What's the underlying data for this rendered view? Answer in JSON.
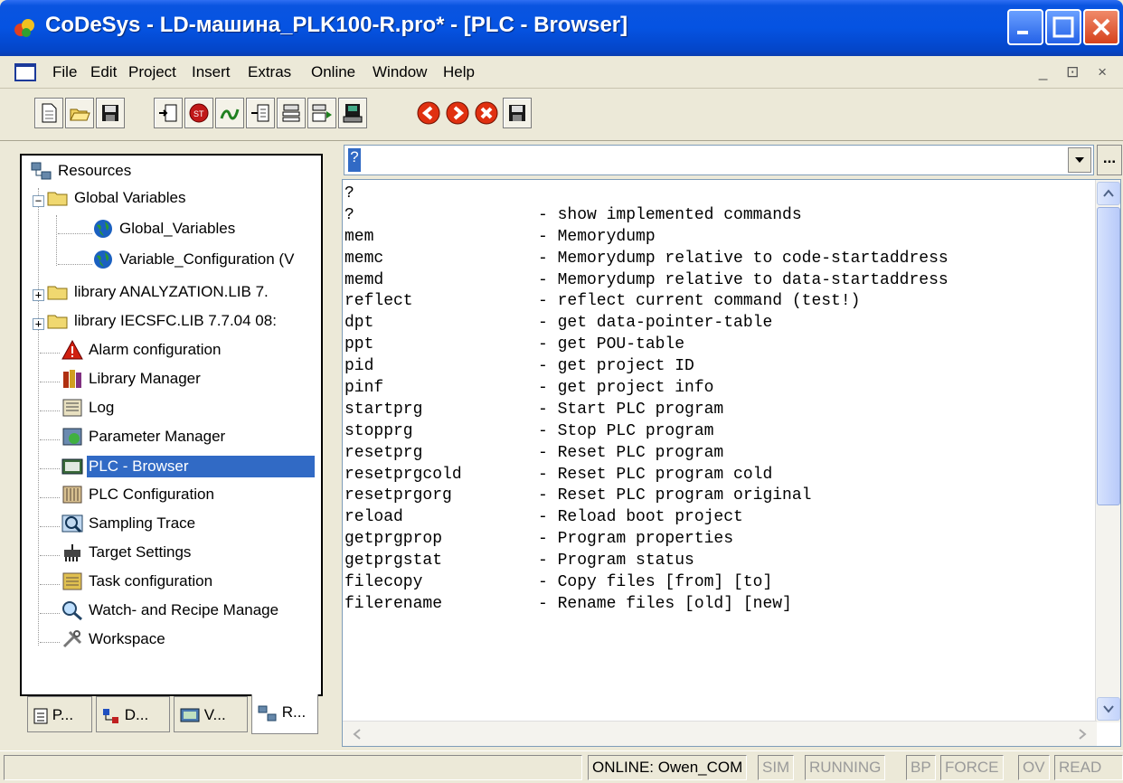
{
  "window": {
    "title": "CoDeSys - LD-машина_PLK100-R.pro* - [PLC - Browser]",
    "buttons": [
      "minimize-icon",
      "maximize-icon",
      "close-icon"
    ]
  },
  "menu": {
    "items": [
      "File",
      "Edit",
      "Project",
      "Insert",
      "Extras",
      "Online",
      "Window",
      "Help"
    ],
    "mdi_controls": "_ ⊡ ×"
  },
  "toolbar": {
    "groups": [
      [
        "new-icon",
        "open-icon",
        "save-icon"
      ],
      [
        "login-icon",
        "stop-icon",
        "run-icon",
        "step-icon",
        "compile-icon",
        "download-icon",
        "upload-icon"
      ],
      [
        "back-icon",
        "forward-icon",
        "cancel-icon",
        "save-file-icon"
      ]
    ]
  },
  "resources_tree": {
    "root": "Resources",
    "items": [
      {
        "label": "Global Variables",
        "level": 1,
        "expander": "−",
        "icon": "folder-icon"
      },
      {
        "label": "Global_Variables",
        "level": 2,
        "icon": "globe-icon"
      },
      {
        "label": "Variable_Configuration (V",
        "level": 2,
        "icon": "globe-icon"
      },
      {
        "label": "library ANALYZATION.LIB 7.",
        "level": 1,
        "expander": "+",
        "icon": "folder-icon"
      },
      {
        "label": "library IECSFC.LIB 7.7.04 08:",
        "level": 1,
        "expander": "+",
        "icon": "folder-icon"
      },
      {
        "label": "Alarm configuration",
        "level": 1,
        "icon": "alarm-icon"
      },
      {
        "label": "Library Manager",
        "level": 1,
        "icon": "books-icon"
      },
      {
        "label": "Log",
        "level": 1,
        "icon": "log-icon"
      },
      {
        "label": "Parameter Manager",
        "level": 1,
        "icon": "parameter-icon"
      },
      {
        "label": "PLC - Browser",
        "level": 1,
        "icon": "plc-browser-icon",
        "selected": true
      },
      {
        "label": "PLC Configuration",
        "level": 1,
        "icon": "plc-config-icon"
      },
      {
        "label": "Sampling Trace",
        "level": 1,
        "icon": "trace-icon"
      },
      {
        "label": "Target Settings",
        "level": 1,
        "icon": "target-icon"
      },
      {
        "label": "Task configuration",
        "level": 1,
        "icon": "task-icon"
      },
      {
        "label": "Watch- and Recipe Manage",
        "level": 1,
        "icon": "magnifier-icon"
      },
      {
        "label": "Workspace",
        "level": 1,
        "icon": "tools-icon"
      }
    ]
  },
  "bottom_tabs": [
    {
      "label": "P...",
      "icon": "pou-icon"
    },
    {
      "label": "D...",
      "icon": "datatype-icon"
    },
    {
      "label": "V...",
      "icon": "visualization-icon"
    },
    {
      "label": "R...",
      "icon": "resources-icon",
      "active": true
    }
  ],
  "browser": {
    "command_value": "?",
    "ellipsis": "...",
    "output": [
      {
        "cmd": "?",
        "desc": ""
      },
      {
        "cmd": "?",
        "desc": "- show implemented commands"
      },
      {
        "cmd": "mem",
        "desc": "- Memorydump"
      },
      {
        "cmd": "memc",
        "desc": "- Memorydump relative to code-startaddress"
      },
      {
        "cmd": "memd",
        "desc": "- Memorydump relative to data-startaddress"
      },
      {
        "cmd": "reflect",
        "desc": "- reflect current command (test!)"
      },
      {
        "cmd": "dpt",
        "desc": "- get data-pointer-table"
      },
      {
        "cmd": "ppt",
        "desc": "- get POU-table"
      },
      {
        "cmd": "pid",
        "desc": "- get project ID"
      },
      {
        "cmd": "pinf",
        "desc": "- get project info"
      },
      {
        "cmd": "startprg",
        "desc": "- Start PLC program"
      },
      {
        "cmd": "stopprg",
        "desc": "- Stop PLC program"
      },
      {
        "cmd": "resetprg",
        "desc": "- Reset PLC program"
      },
      {
        "cmd": "resetprgcold",
        "desc": "- Reset PLC program cold"
      },
      {
        "cmd": "resetprgorg",
        "desc": "- Reset PLC program original"
      },
      {
        "cmd": "reload",
        "desc": "- Reload boot project"
      },
      {
        "cmd": "getprgprop",
        "desc": "- Program properties"
      },
      {
        "cmd": "getprgstat",
        "desc": "- Program status"
      },
      {
        "cmd": "filecopy",
        "desc": "- Copy files [from] [to]"
      },
      {
        "cmd": "filerename",
        "desc": "- Rename files [old] [new]"
      }
    ]
  },
  "status": {
    "online": "ONLINE: Owen_COM",
    "flags": [
      "SIM",
      "RUNNING",
      "BP",
      "FORCE",
      "OV",
      "READ"
    ]
  }
}
